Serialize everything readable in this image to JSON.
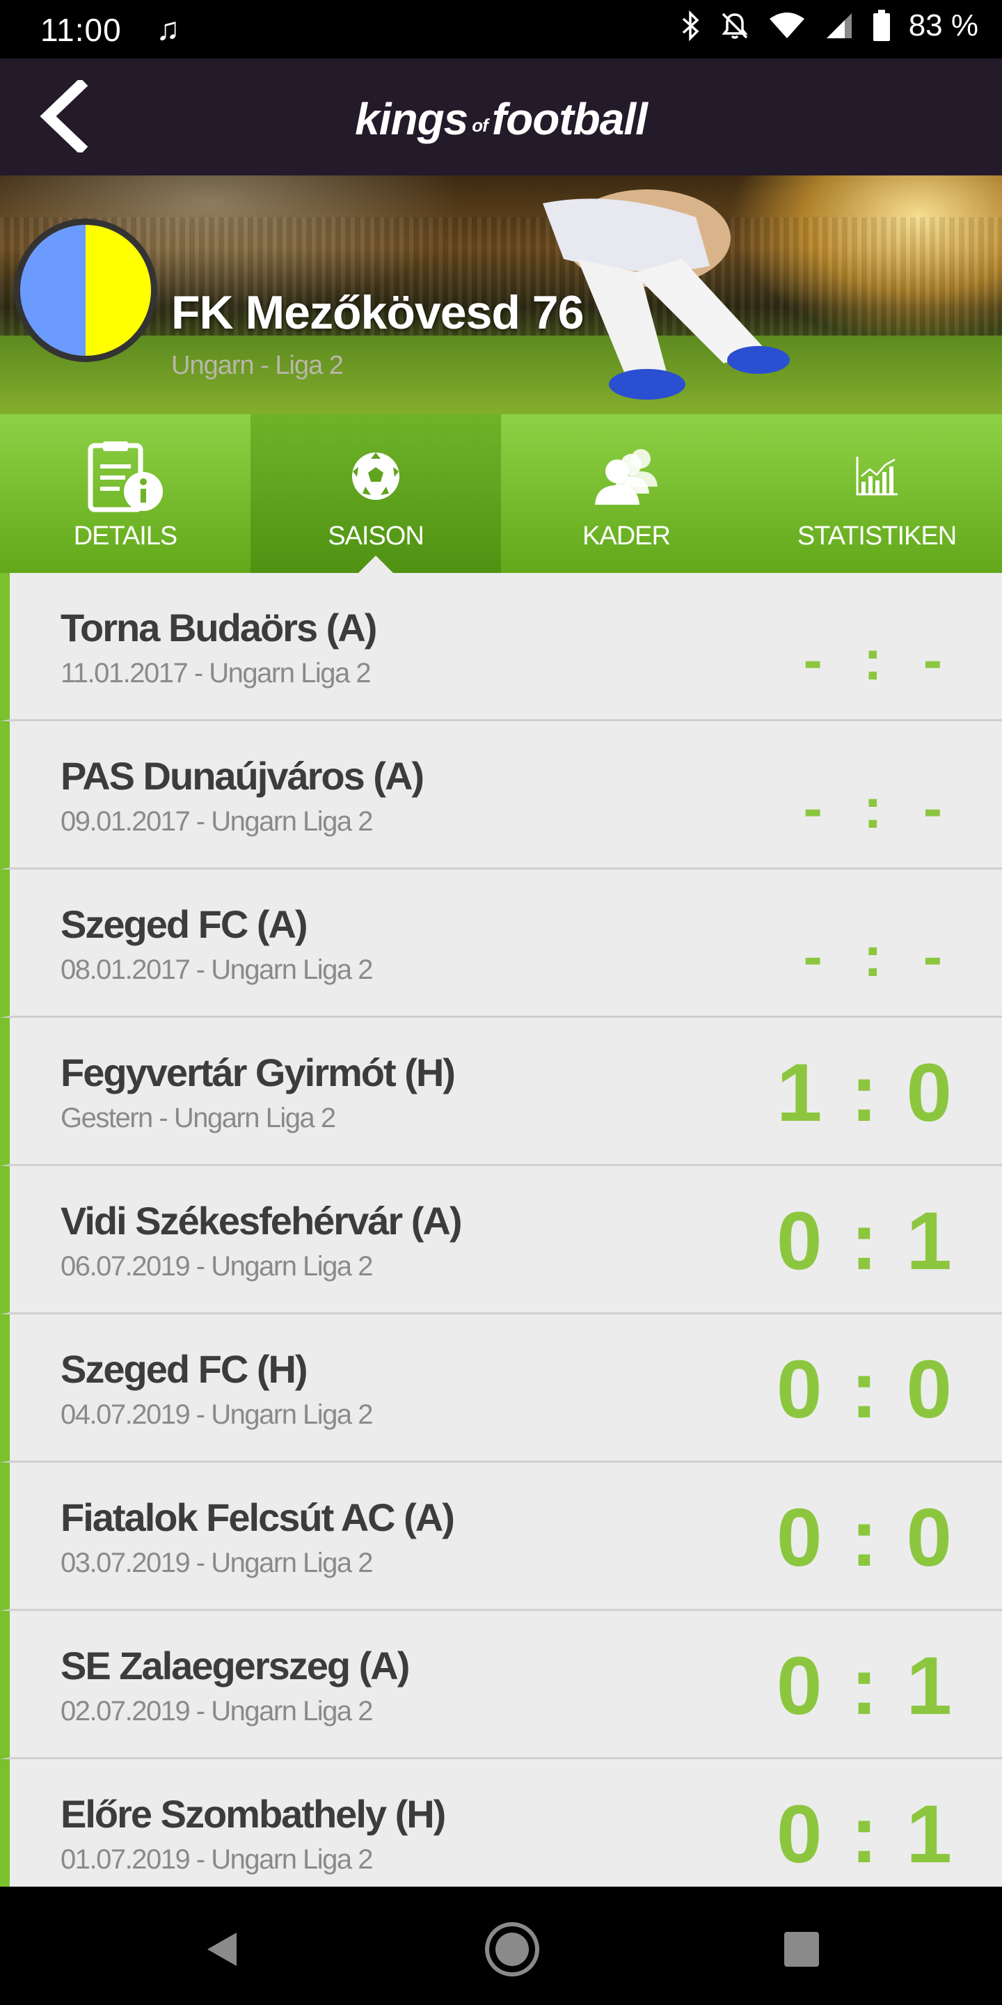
{
  "status_bar": {
    "time": "11:00",
    "battery_percent": "83 %",
    "icons": [
      "music-note-icon",
      "bluetooth-icon",
      "notifications-off-icon",
      "wifi-icon",
      "cell-signal-icon",
      "battery-icon"
    ]
  },
  "app_bar": {
    "logo_part1": "kings",
    "logo_part2": "of",
    "logo_part3": "football",
    "back_icon": "chevron-left-icon"
  },
  "club": {
    "name": "FK Mezőkövesd 76",
    "league": "Ungarn - Liga 2",
    "crest_colors": [
      "#6b9bff",
      "#ffff00"
    ]
  },
  "tabs": [
    {
      "label": "DETAILS",
      "icon": "document-info-icon",
      "active": false
    },
    {
      "label": "SAISON",
      "icon": "soccer-ball-icon",
      "active": true
    },
    {
      "label": "KADER",
      "icon": "team-icon",
      "active": false
    },
    {
      "label": "STATISTIKEN",
      "icon": "bar-chart-icon",
      "active": false
    }
  ],
  "matches": [
    {
      "opponent": "Torna Budaörs (A)",
      "meta": "11.01.2017 - Ungarn Liga 2",
      "score": "- : -",
      "pending": true
    },
    {
      "opponent": "PAS Dunaújváros (A)",
      "meta": "09.01.2017 - Ungarn Liga 2",
      "score": "- : -",
      "pending": true
    },
    {
      "opponent": "Szeged FC (A)",
      "meta": "08.01.2017 - Ungarn Liga 2",
      "score": "- : -",
      "pending": true
    },
    {
      "opponent": "Fegyvertár Gyirmót (H)",
      "meta": "Gestern - Ungarn Liga 2",
      "score": "1 : 0",
      "pending": false
    },
    {
      "opponent": "Vidi Székesfehérvár (A)",
      "meta": "06.07.2019 - Ungarn Liga 2",
      "score": "0 : 1",
      "pending": false
    },
    {
      "opponent": "Szeged FC (H)",
      "meta": "04.07.2019 - Ungarn Liga 2",
      "score": "0 : 0",
      "pending": false
    },
    {
      "opponent": "Fiatalok Felcsút AC (A)",
      "meta": "03.07.2019 - Ungarn Liga 2",
      "score": "0 : 0",
      "pending": false
    },
    {
      "opponent": "SE Zalaegerszeg (A)",
      "meta": "02.07.2019 - Ungarn Liga 2",
      "score": "0 : 1",
      "pending": false
    },
    {
      "opponent": "Előre Szombathely (H)",
      "meta": "01.07.2019 - Ungarn Liga 2",
      "score": "0 : 1",
      "pending": false
    }
  ],
  "colors": {
    "accent_green": "#8cc63f",
    "header_dark": "#231a2a"
  },
  "nav_bar": {
    "icons": [
      "back-triangle-icon",
      "home-circle-icon",
      "recents-square-icon"
    ]
  }
}
